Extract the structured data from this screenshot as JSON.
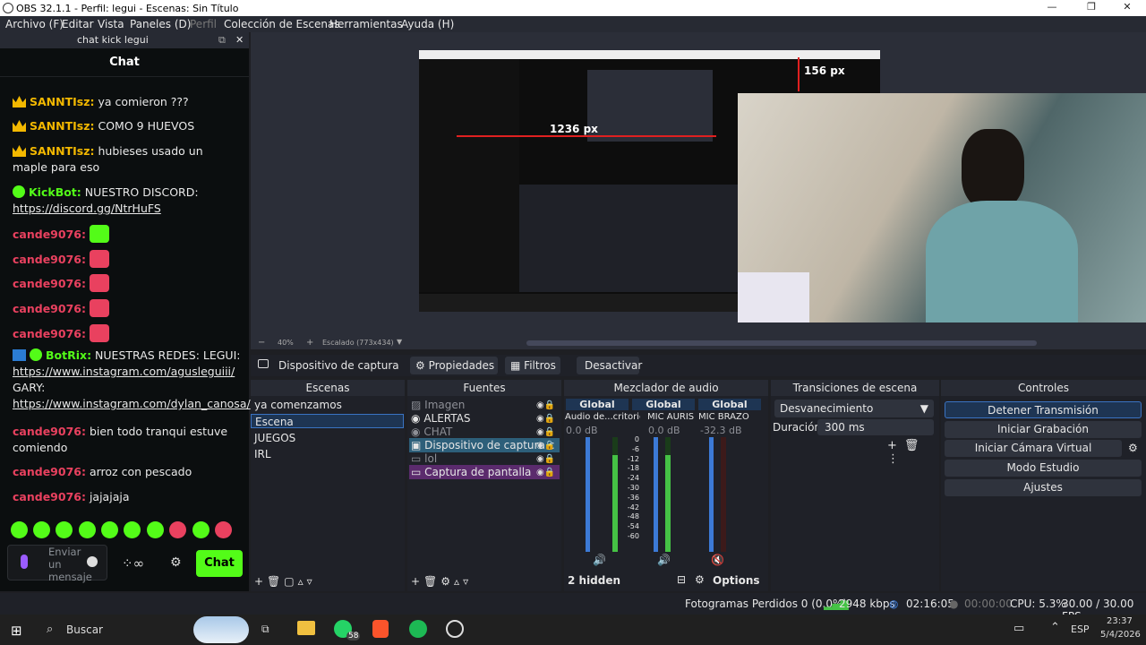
{
  "window": {
    "title": "OBS 32.1.1 - Perfil: legui - Escenas: Sin Título",
    "minimize": "—",
    "maximize": "❐",
    "close": "✕"
  },
  "menu": [
    "Archivo (F)",
    "Editar",
    "Vista",
    "Paneles (D)",
    "Perfil",
    "Colección de Escenas",
    "Herramientas",
    "Ayuda (H)"
  ],
  "chat_dock": {
    "dock_title": "chat kick legui",
    "header": "Chat",
    "messages": [
      {
        "user": "SANNTIsz:",
        "text": "ya comieron ???"
      },
      {
        "user": "SANNTIsz:",
        "text": "COMO 9 HUEVOS"
      },
      {
        "user": "SANNTIsz:",
        "text": "hubieses usado un maple para eso"
      },
      {
        "user": "KickBot:",
        "text": "NUESTRO DISCORD:",
        "link": "https://discord.gg/NtrHuFS"
      },
      {
        "user": "cande9076:",
        "text": ""
      },
      {
        "user": "cande9076:",
        "text": ""
      },
      {
        "user": "cande9076:",
        "text": ""
      },
      {
        "user": "cande9076:",
        "text": ""
      },
      {
        "user": "cande9076:",
        "text": ""
      },
      {
        "user": "BotRix:",
        "text": "NUESTRAS REDES: LEGUI:",
        "link": "https://www.instagram.com/agusleguiii/",
        "text2": "GARY:",
        "link2": "https://www.instagram.com/dylan_canosa/"
      },
      {
        "user": "cande9076:",
        "text": "bien todo tranqui estuve comiendo"
      },
      {
        "user": "cande9076:",
        "text": "arroz con pescado"
      },
      {
        "user": "cande9076:",
        "text": "jajajaja"
      }
    ],
    "input_placeholder": "Enviar un mensaje",
    "send_label": "Chat"
  },
  "preview": {
    "measure_h": "156 px",
    "measure_w": "1236 px",
    "zoom": "40%",
    "scale_label": "Escalado (773x434)"
  },
  "source_toolbar": {
    "source_name": "Dispositivo de captura de v",
    "properties": "Propiedades",
    "filters": "Filtros",
    "deactivate": "Desactivar"
  },
  "scenes": {
    "title": "Escenas",
    "items": [
      "ya comenzamos",
      "Escena",
      "JUEGOS",
      "IRL"
    ],
    "selected": 1
  },
  "sources": {
    "title": "Fuentes",
    "items": [
      "Imagen",
      "ALERTAS",
      "CHAT",
      "Dispositivo de captura c",
      "lol",
      "Captura de pantalla"
    ]
  },
  "mixer": {
    "title": "Mezclador de audio",
    "channels": [
      {
        "tag": "Global",
        "name": "Audio de...critorio",
        "db": "0.0 dB"
      },
      {
        "tag": "Global",
        "name": "MIC AURIS",
        "db": "0.0 dB"
      },
      {
        "tag": "Global",
        "name": "MIC BRAZO",
        "db": "-32.3 dB"
      }
    ],
    "scale": [
      "0",
      "-6",
      "-12",
      "-18",
      "-24",
      "-30",
      "-36",
      "-42",
      "-48",
      "-54",
      "-60"
    ],
    "hidden": "2 hidden",
    "options": "Options"
  },
  "transitions": {
    "title": "Transiciones de escena",
    "selected": "Desvanecimiento",
    "duration_label": "Duración",
    "duration_value": "300 ms"
  },
  "controls": {
    "title": "Controles",
    "buttons": [
      "Detener Transmisión",
      "Iniciar Grabación",
      "Iniciar Cámara Virtual",
      "Modo Estudio",
      "Ajustes"
    ]
  },
  "status": {
    "dropped": "Fotogramas Perdidos 0 (0.0%)",
    "bitrate": "2948 kbps",
    "stream_time": "02:16:05",
    "rec_time": "00:00:00",
    "cpu": "CPU: 5.3%",
    "fps": "30.00 / 30.00 FPS"
  },
  "taskbar": {
    "search": "Buscar",
    "whatsapp_badge": "58",
    "lang": "ESP",
    "time": "23:37",
    "date": "5/4/2026"
  },
  "colors": {
    "kick_green": "#53fc18",
    "user_pink": "#e9415f",
    "crown": "#f3b800"
  }
}
